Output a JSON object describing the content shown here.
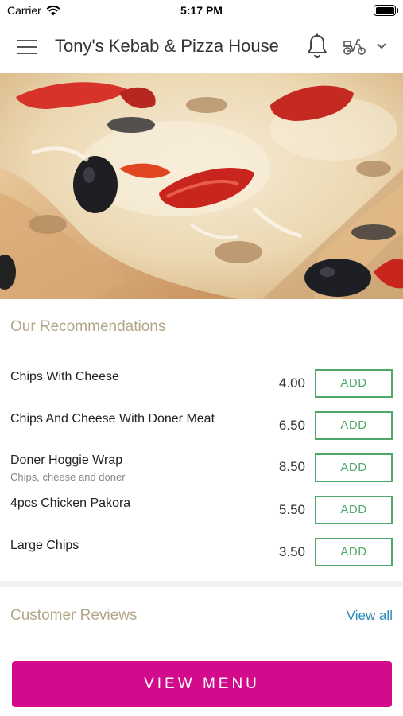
{
  "status_bar": {
    "carrier": "Carrier",
    "time": "5:17 PM"
  },
  "header": {
    "title": "Tony's Kebab & Pizza House",
    "icons": [
      "menu-icon",
      "bell-icon",
      "delivery-scooter-icon",
      "chevron-down-icon"
    ]
  },
  "hero": {
    "image_description_icon": "pizza-photo"
  },
  "recommendations": {
    "title": "Our Recommendations",
    "items": [
      {
        "name": "Chips With Cheese",
        "description": "",
        "price": "4.00",
        "button": "ADD"
      },
      {
        "name": "Chips And Cheese With Doner Meat",
        "description": "",
        "price": "6.50",
        "button": "ADD"
      },
      {
        "name": "Doner Hoggie Wrap",
        "description": "Chips, cheese and doner",
        "price": "8.50",
        "button": "ADD"
      },
      {
        "name": "4pcs Chicken Pakora",
        "description": "",
        "price": "5.50",
        "button": "ADD"
      },
      {
        "name": "Large Chips",
        "description": "",
        "price": "3.50",
        "button": "ADD"
      }
    ]
  },
  "reviews": {
    "title": "Customer Reviews",
    "view_all": "View all"
  },
  "footer": {
    "view_menu": "VIEW MENU"
  },
  "colors": {
    "accent_magenta": "#d10b8b",
    "add_green": "#4ea86a",
    "section_title": "#b3a789",
    "link_blue": "#2a8bb8"
  }
}
